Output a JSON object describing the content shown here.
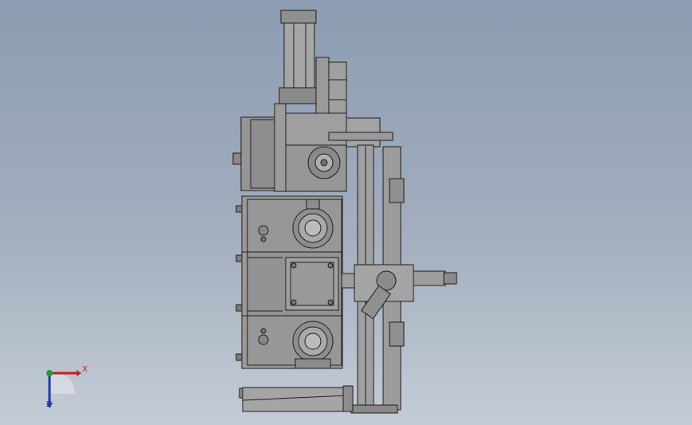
{
  "viewport": {
    "background_top": "#8c9cb2",
    "background_bottom": "#c4ccd6",
    "model_fill": "#939393",
    "model_line": "#1e1e1e"
  },
  "triad": {
    "x_label": "X",
    "z_label": "Z",
    "x_color": "#c81e1e",
    "y_color": "#1f9e2f",
    "z_color": "#2233b0"
  }
}
